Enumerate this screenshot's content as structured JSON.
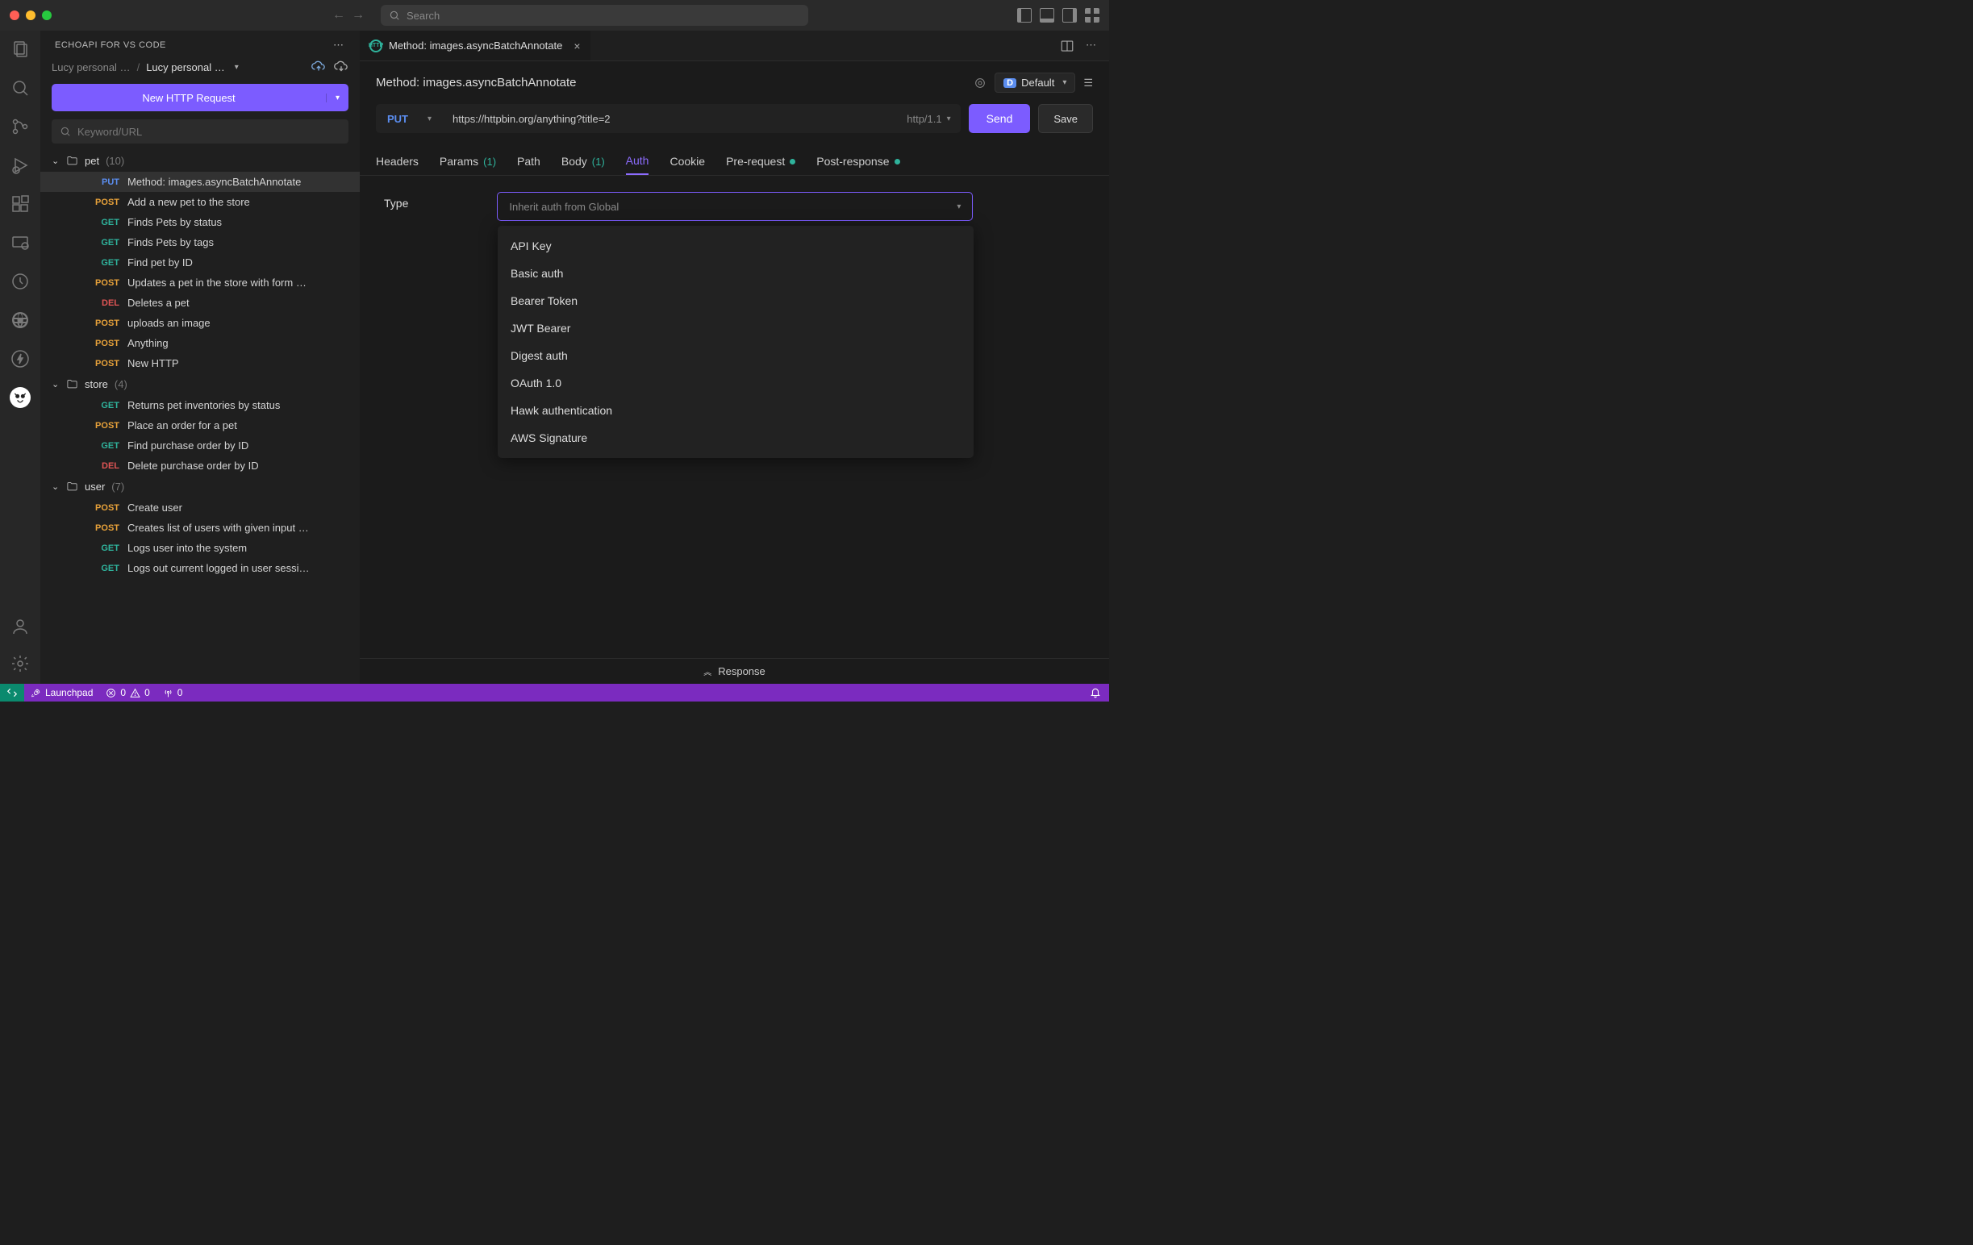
{
  "titlebar": {
    "search_placeholder": "Search"
  },
  "sidebar": {
    "title": "ECHOAPI FOR VS CODE",
    "breadcrumb": {
      "parent": "Lucy personal …",
      "current": "Lucy personal …"
    },
    "new_request_btn": "New HTTP Request",
    "filter_placeholder": "Keyword/URL",
    "folders": [
      {
        "name": "pet",
        "count": "(10)",
        "items": [
          {
            "method": "PUT",
            "label": "Method: images.asyncBatchAnnotate",
            "selected": true
          },
          {
            "method": "POST",
            "label": "Add a new pet to the store"
          },
          {
            "method": "GET",
            "label": "Finds Pets by status"
          },
          {
            "method": "GET",
            "label": "Finds Pets by tags"
          },
          {
            "method": "GET",
            "label": "Find pet by ID"
          },
          {
            "method": "POST",
            "label": "Updates a pet in the store with form …"
          },
          {
            "method": "DEL",
            "label": "Deletes a pet"
          },
          {
            "method": "POST",
            "label": "uploads an image"
          },
          {
            "method": "POST",
            "label": "Anything"
          },
          {
            "method": "POST",
            "label": "New HTTP"
          }
        ]
      },
      {
        "name": "store",
        "count": "(4)",
        "items": [
          {
            "method": "GET",
            "label": "Returns pet inventories by status"
          },
          {
            "method": "POST",
            "label": "Place an order for a pet"
          },
          {
            "method": "GET",
            "label": "Find purchase order by ID"
          },
          {
            "method": "DEL",
            "label": "Delete purchase order by ID"
          }
        ]
      },
      {
        "name": "user",
        "count": "(7)",
        "items": [
          {
            "method": "POST",
            "label": "Create user"
          },
          {
            "method": "POST",
            "label": "Creates list of users with given input …"
          },
          {
            "method": "GET",
            "label": "Logs user into the system"
          },
          {
            "method": "GET",
            "label": "Logs out current logged in user sessi…"
          }
        ]
      }
    ]
  },
  "editor": {
    "tab_label": "Method: images.asyncBatchAnnotate",
    "request_title": "Method: images.asyncBatchAnnotate",
    "env_label": "Default",
    "method": "PUT",
    "url": "https://httpbin.org/anything?title=2",
    "protocol": "http/1.1",
    "send_btn": "Send",
    "save_btn": "Save",
    "tabs": {
      "headers": "Headers",
      "params": "Params",
      "params_count": "(1)",
      "path": "Path",
      "body": "Body",
      "body_count": "(1)",
      "auth": "Auth",
      "cookie": "Cookie",
      "pre": "Pre-request",
      "post": "Post-response"
    },
    "auth": {
      "type_label": "Type",
      "select_placeholder": "Inherit auth from Global",
      "options": [
        "API Key",
        "Basic auth",
        "Bearer Token",
        "JWT Bearer",
        "Digest auth",
        "OAuth 1.0",
        "Hawk authentication",
        "AWS Signature"
      ]
    },
    "response_label": "Response"
  },
  "statusbar": {
    "launchpad": "Launchpad",
    "errors": "0",
    "warnings": "0",
    "ports": "0"
  }
}
